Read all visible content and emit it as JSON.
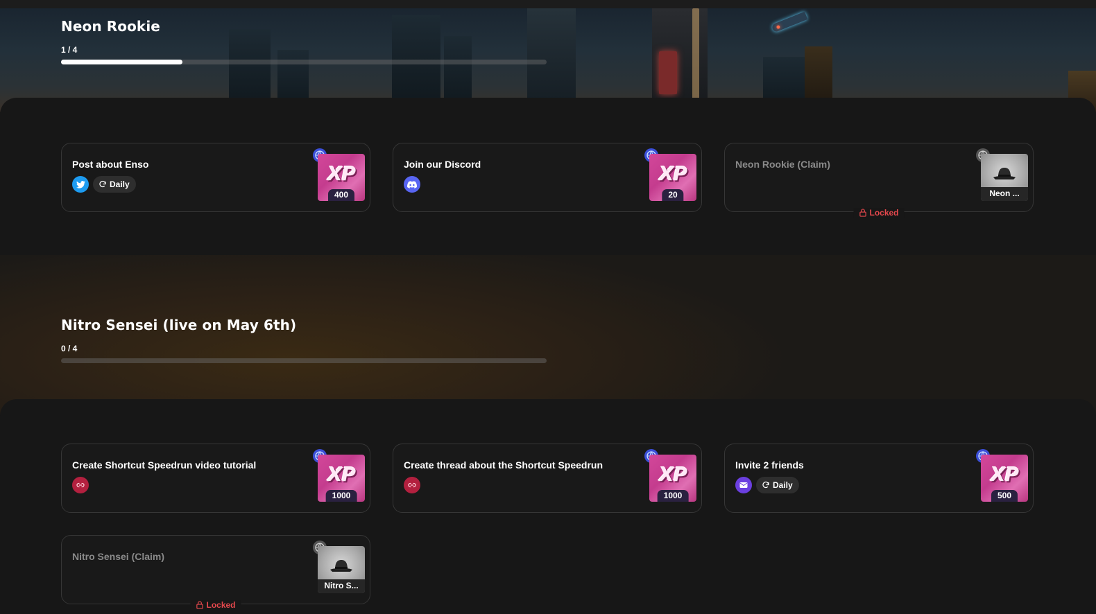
{
  "sections": [
    {
      "title": "Neon Rookie",
      "progress_text": "1 / 4",
      "progress_fraction": 0.25,
      "cards": [
        {
          "title": "Post about Enso",
          "platform_icon": "twitter-icon",
          "frequency": "Daily",
          "reward_type": "xp",
          "reward_art": "XP",
          "reward_value": "400",
          "locked": false
        },
        {
          "title": "Join our Discord",
          "platform_icon": "discord-icon",
          "frequency": "",
          "reward_type": "xp",
          "reward_art": "XP",
          "reward_value": "20",
          "locked": false
        },
        {
          "title": "Neon Rookie (Claim)",
          "platform_icon": "",
          "frequency": "",
          "reward_type": "nft",
          "reward_value": "Neon ...",
          "locked": true,
          "locked_label": "Locked"
        }
      ]
    },
    {
      "title": "Nitro Sensei (live on May 6th)",
      "progress_text": "0 / 4",
      "progress_fraction": 0,
      "cards": [
        {
          "title": "Create Shortcut Speedrun video tutorial",
          "platform_icon": "link-icon",
          "frequency": "",
          "reward_type": "xp",
          "reward_art": "XP",
          "reward_value": "1000",
          "locked": false
        },
        {
          "title": "Create thread about the Shortcut Speedrun",
          "platform_icon": "link-icon",
          "frequency": "",
          "reward_type": "xp",
          "reward_art": "XP",
          "reward_value": "1000",
          "locked": false
        },
        {
          "title": "Invite 2 friends",
          "platform_icon": "mail-icon",
          "frequency": "Daily",
          "reward_type": "xp",
          "reward_art": "XP",
          "reward_value": "500",
          "locked": false
        },
        {
          "title": "Nitro Sensei (Claim)",
          "platform_icon": "",
          "frequency": "",
          "reward_type": "nft",
          "reward_value": "Nitro S...",
          "locked": true,
          "locked_label": "Locked"
        }
      ]
    }
  ],
  "colors": {
    "twitter": "#1d9bf0",
    "discord": "#5865f2",
    "link": "#b3203f",
    "mail": "#6b3fe0",
    "globe": "#3b4fd8",
    "locked": "#e5484d"
  }
}
